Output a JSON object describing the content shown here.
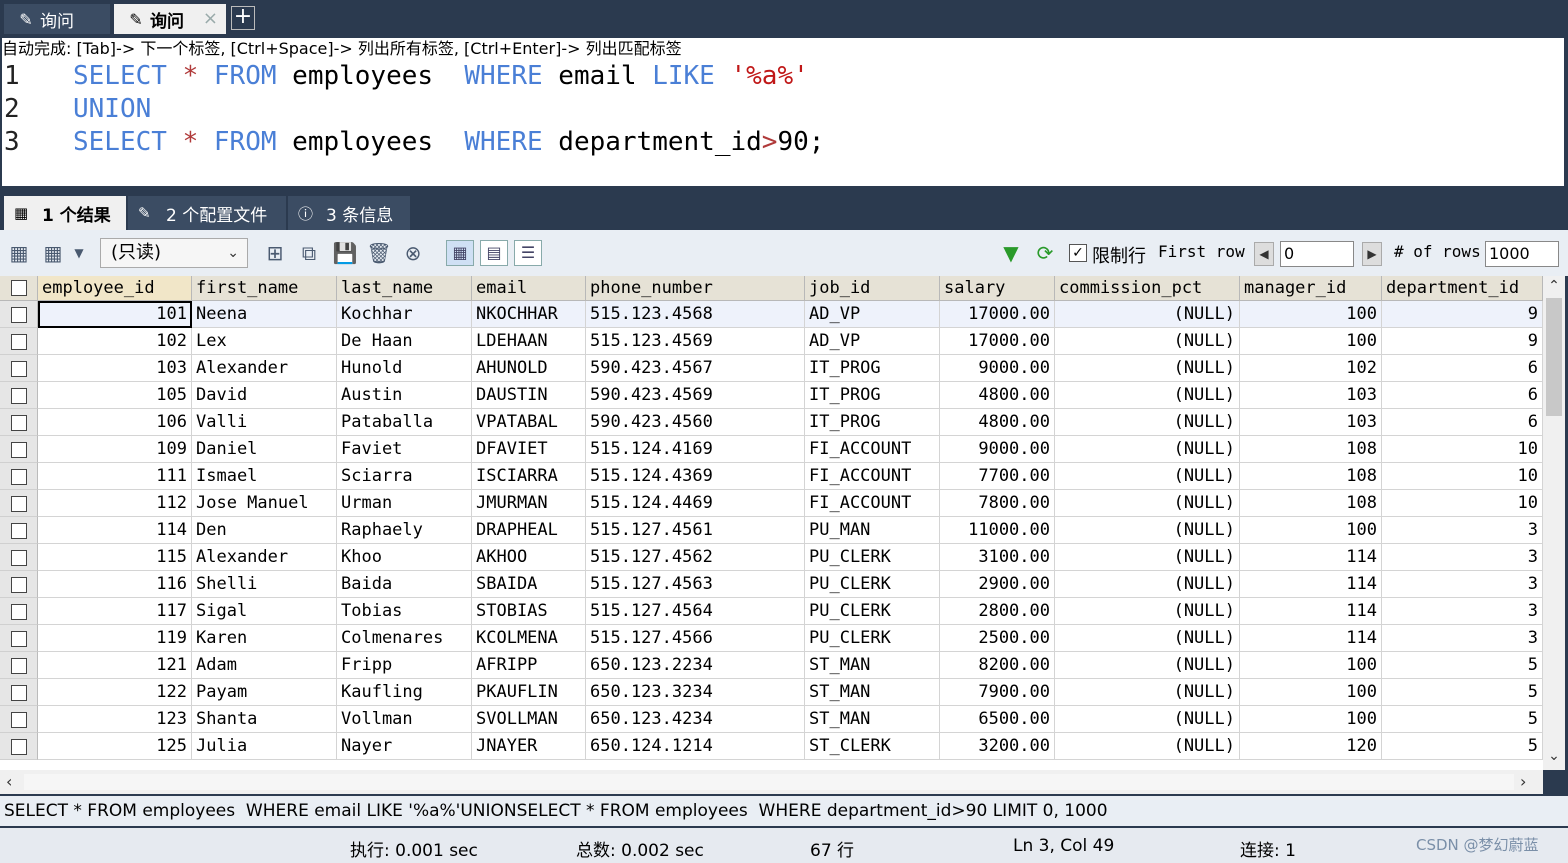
{
  "tabs": [
    {
      "label": "询问",
      "active": false,
      "icon": "query-icon"
    },
    {
      "label": "询问",
      "active": true,
      "icon": "query-icon"
    }
  ],
  "new_tab_label": "+",
  "editor": {
    "hint": "自动完成: [Tab]-> 下一个标签, [Ctrl+Space]-> 列出所有标签, [Ctrl+Enter]-> 列出匹配标签",
    "lines": [
      {
        "num": "1",
        "tokens": [
          {
            "t": "SELECT",
            "c": "kw"
          },
          {
            "t": " ",
            "c": "plain"
          },
          {
            "t": "*",
            "c": "op"
          },
          {
            "t": " ",
            "c": "plain"
          },
          {
            "t": "FROM",
            "c": "kw"
          },
          {
            "t": " employees  ",
            "c": "plain"
          },
          {
            "t": "WHERE",
            "c": "kw"
          },
          {
            "t": " email ",
            "c": "plain"
          },
          {
            "t": "LIKE",
            "c": "kw"
          },
          {
            "t": " ",
            "c": "plain"
          },
          {
            "t": "'%a%'",
            "c": "str"
          }
        ]
      },
      {
        "num": "2",
        "tokens": [
          {
            "t": "UNION",
            "c": "kw"
          }
        ]
      },
      {
        "num": "3",
        "tokens": [
          {
            "t": "SELECT",
            "c": "kw"
          },
          {
            "t": " ",
            "c": "plain"
          },
          {
            "t": "*",
            "c": "op"
          },
          {
            "t": " ",
            "c": "plain"
          },
          {
            "t": "FROM",
            "c": "kw"
          },
          {
            "t": " employees  ",
            "c": "plain"
          },
          {
            "t": "WHERE",
            "c": "kw"
          },
          {
            "t": " department_id",
            "c": "plain"
          },
          {
            "t": ">",
            "c": "op"
          },
          {
            "t": "90;",
            "c": "plain"
          }
        ]
      }
    ]
  },
  "result_tabs": [
    {
      "label": "1 个结果",
      "icon": "result-icon"
    },
    {
      "label": "2 个配置文件",
      "icon": "profile-icon"
    },
    {
      "label": "3 条信息",
      "icon": "info-icon"
    }
  ],
  "toolbar": {
    "readonly_label": "(只读)",
    "limit_label": "限制行",
    "limit_checked": true,
    "first_row_label": "First row",
    "first_row_value": "0",
    "rows_label": "# of rows",
    "rows_value": "1000"
  },
  "grid": {
    "columns": [
      "employee_id",
      "first_name",
      "last_name",
      "email",
      "phone_number",
      "job_id",
      "salary",
      "commission_pct",
      "manager_id",
      "department_id"
    ],
    "rows": [
      [
        "101",
        "Neena",
        "Kochhar",
        "NKOCHHAR",
        "515.123.4568",
        "AD_VP",
        "17000.00",
        "(NULL)",
        "100",
        "9"
      ],
      [
        "102",
        "Lex",
        "De Haan",
        "LDEHAAN",
        "515.123.4569",
        "AD_VP",
        "17000.00",
        "(NULL)",
        "100",
        "9"
      ],
      [
        "103",
        "Alexander",
        "Hunold",
        "AHUNOLD",
        "590.423.4567",
        "IT_PROG",
        "9000.00",
        "(NULL)",
        "102",
        "6"
      ],
      [
        "105",
        "David",
        "Austin",
        "DAUSTIN",
        "590.423.4569",
        "IT_PROG",
        "4800.00",
        "(NULL)",
        "103",
        "6"
      ],
      [
        "106",
        "Valli",
        "Pataballa",
        "VPATABAL",
        "590.423.4560",
        "IT_PROG",
        "4800.00",
        "(NULL)",
        "103",
        "6"
      ],
      [
        "109",
        "Daniel",
        "Faviet",
        "DFAVIET",
        "515.124.4169",
        "FI_ACCOUNT",
        "9000.00",
        "(NULL)",
        "108",
        "10"
      ],
      [
        "111",
        "Ismael",
        "Sciarra",
        "ISCIARRA",
        "515.124.4369",
        "FI_ACCOUNT",
        "7700.00",
        "(NULL)",
        "108",
        "10"
      ],
      [
        "112",
        "Jose Manuel",
        "Urman",
        "JMURMAN",
        "515.124.4469",
        "FI_ACCOUNT",
        "7800.00",
        "(NULL)",
        "108",
        "10"
      ],
      [
        "114",
        "Den",
        "Raphaely",
        "DRAPHEAL",
        "515.127.4561",
        "PU_MAN",
        "11000.00",
        "(NULL)",
        "100",
        "3"
      ],
      [
        "115",
        "Alexander",
        "Khoo",
        "AKHOO",
        "515.127.4562",
        "PU_CLERK",
        "3100.00",
        "(NULL)",
        "114",
        "3"
      ],
      [
        "116",
        "Shelli",
        "Baida",
        "SBAIDA",
        "515.127.4563",
        "PU_CLERK",
        "2900.00",
        "(NULL)",
        "114",
        "3"
      ],
      [
        "117",
        "Sigal",
        "Tobias",
        "STOBIAS",
        "515.127.4564",
        "PU_CLERK",
        "2800.00",
        "(NULL)",
        "114",
        "3"
      ],
      [
        "119",
        "Karen",
        "Colmenares",
        "KCOLMENA",
        "515.127.4566",
        "PU_CLERK",
        "2500.00",
        "(NULL)",
        "114",
        "3"
      ],
      [
        "121",
        "Adam",
        "Fripp",
        "AFRIPP",
        "650.123.2234",
        "ST_MAN",
        "8200.00",
        "(NULL)",
        "100",
        "5"
      ],
      [
        "122",
        "Payam",
        "Kaufling",
        "PKAUFLIN",
        "650.123.3234",
        "ST_MAN",
        "7900.00",
        "(NULL)",
        "100",
        "5"
      ],
      [
        "123",
        "Shanta",
        "Vollman",
        "SVOLLMAN",
        "650.123.4234",
        "ST_MAN",
        "6500.00",
        "(NULL)",
        "100",
        "5"
      ],
      [
        "125",
        "Julia",
        "Nayer",
        "JNAYER",
        "650.124.1214",
        "ST_CLERK",
        "3200.00",
        "(NULL)",
        "120",
        "5"
      ]
    ]
  },
  "sql_status": "SELECT * FROM employees  WHERE email LIKE '%a%'UNIONSELECT * FROM employees  WHERE department_id>90 LIMIT 0, 1000",
  "status": {
    "exec": "执行: 0.001 sec",
    "total": "总数: 0.002 sec",
    "rows": "67 行",
    "cursor": "Ln 3, Col 49",
    "conn": "连接: 1",
    "watermark": "CSDN @梦幻蔚蓝"
  }
}
